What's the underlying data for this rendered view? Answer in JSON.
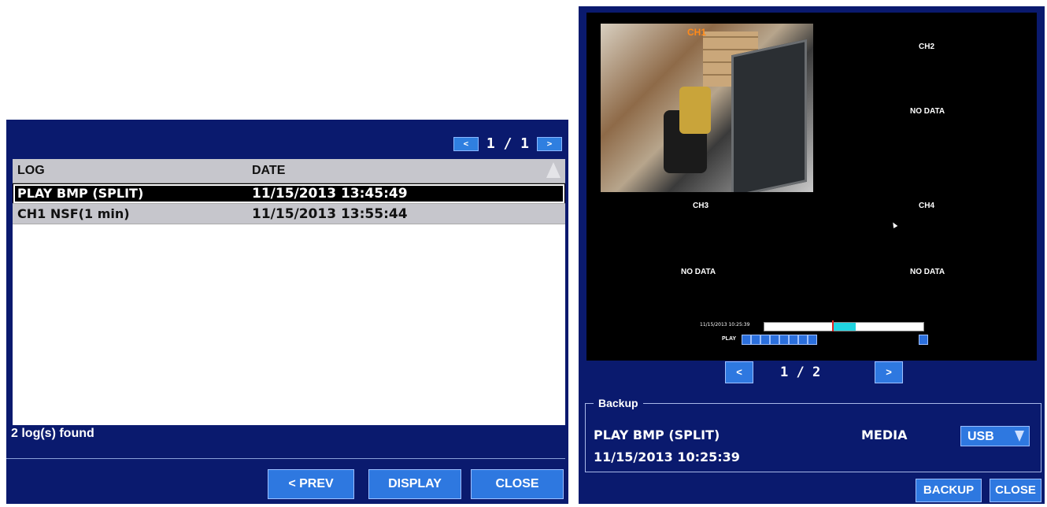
{
  "left": {
    "pager": {
      "prev_icon": "<",
      "text": "1 / 1",
      "next_icon": ">"
    },
    "table": {
      "headers": {
        "log": "LOG",
        "date": "DATE"
      },
      "rows": [
        {
          "log": "PLAY BMP (SPLIT)",
          "date": "11/15/2013 13:45:49"
        },
        {
          "log": "CH1 NSF(1 min)",
          "date": "11/15/2013 13:55:44"
        }
      ]
    },
    "found": "2 log(s) found",
    "buttons": {
      "prev": "< PREV",
      "display": "DISPLAY",
      "close": "CLOSE"
    }
  },
  "right": {
    "channels": {
      "ch1": "CH1",
      "ch2": "CH2",
      "ch3": "CH3",
      "ch4": "CH4"
    },
    "no_data": "NO DATA",
    "timestamp_small": "11/15/2013  10:25:39",
    "play_label": "PLAY",
    "pager": {
      "prev": "<",
      "text": "1 / 2",
      "next": ">"
    },
    "backup": {
      "title": "Backup",
      "name": "PLAY BMP (SPLIT)",
      "timestamp": "11/15/2013 10:25:39",
      "media_label": "MEDIA",
      "media_value": "USB"
    },
    "buttons": {
      "backup": "BACKUP",
      "close": "CLOSE"
    }
  },
  "colors": {
    "panel": "#0a1a6e",
    "button": "#2e78e0",
    "accent_cyan": "#20d4e0",
    "ch1_label": "#ff8a1a"
  }
}
